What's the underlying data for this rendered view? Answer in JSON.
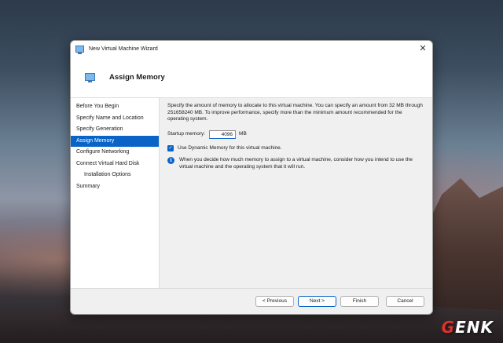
{
  "window": {
    "title": "New Virtual Machine Wizard",
    "close_glyph": "✕"
  },
  "header": {
    "title": "Assign Memory",
    "icon": "virtual-machine-icon"
  },
  "nav": {
    "items": [
      {
        "label": "Before You Begin",
        "active": false,
        "sub": false
      },
      {
        "label": "Specify Name and Location",
        "active": false,
        "sub": false
      },
      {
        "label": "Specify Generation",
        "active": false,
        "sub": false
      },
      {
        "label": "Assign Memory",
        "active": true,
        "sub": false
      },
      {
        "label": "Configure Networking",
        "active": false,
        "sub": false
      },
      {
        "label": "Connect Virtual Hard Disk",
        "active": false,
        "sub": false
      },
      {
        "label": "Installation Options",
        "active": false,
        "sub": true
      },
      {
        "label": "Summary",
        "active": false,
        "sub": false
      }
    ]
  },
  "content": {
    "description": "Specify the amount of memory to allocate to this virtual machine. You can specify an amount from 32 MB through 251658240 MB. To improve performance, specify more than the minimum amount recommended for the operating system.",
    "startup_memory_label": "Startup memory:",
    "startup_memory_value": "4096",
    "startup_memory_unit": "MB",
    "dynamic_memory_label": "Use Dynamic Memory for this virtual machine.",
    "dynamic_memory_checked": true,
    "checkmark": "✓",
    "info_glyph": "i",
    "info_text": "When you decide how much memory to assign to a virtual machine, consider how you intend to use the virtual machine and the operating system that it will run."
  },
  "footer": {
    "previous_label": "< Previous",
    "next_label": "Next >",
    "finish_label": "Finish",
    "cancel_label": "Cancel"
  },
  "watermark": {
    "text_a": "G",
    "text_b": "ENK"
  },
  "colors": {
    "accent": "#0a64c8"
  }
}
